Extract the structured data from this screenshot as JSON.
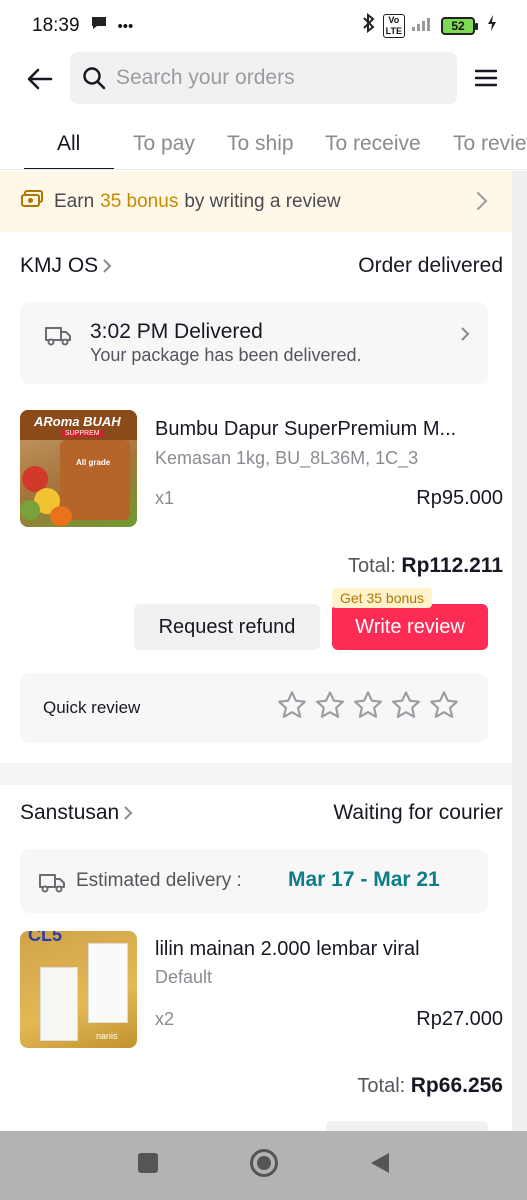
{
  "status_bar": {
    "time": "18:39",
    "dots": "•••",
    "battery": "52"
  },
  "header": {
    "search_placeholder": "Search your orders"
  },
  "tabs": [
    {
      "label": "All"
    },
    {
      "label": "To pay"
    },
    {
      "label": "To ship"
    },
    {
      "label": "To receive"
    },
    {
      "label": "To review"
    }
  ],
  "banner": {
    "prefix": "Earn",
    "bonus": "35 bonus",
    "suffix": "by writing a review"
  },
  "orders": [
    {
      "shop": "KMJ OS",
      "status": "Order delivered",
      "delivery_title": "3:02 PM Delivered",
      "delivery_sub": "Your package has been delivered.",
      "product_name": "Bumbu Dapur SuperPremium M...",
      "variant": "Kemasan 1kg, BU_8L36M, 1C_3",
      "qty": "x1",
      "price": "Rp95.000",
      "total_label": "Total:",
      "total": "Rp112.211",
      "refund_label": "Request refund",
      "review_label": "Write review",
      "bonus_tag": "Get 35 bonus",
      "quick_review_label": "Quick review",
      "image_text_top": "ARoma BUAH",
      "image_text_sub": "SUPPREM",
      "image_text_grade": "All grade"
    },
    {
      "shop": "Sanstusan",
      "status": "Waiting for courier",
      "delivery_prefix": "Estimated delivery :",
      "delivery_dates": "Mar 17 - Mar 21",
      "product_name": "lilin mainan 2.000 lembar viral",
      "variant": "Default",
      "qty": "x2",
      "price": "Rp27.000",
      "total_label": "Total:",
      "total": "Rp66.256",
      "image_text_top": "CL5",
      "image_text_mark": "nanis"
    }
  ],
  "colors": {
    "accent": "#fe2c55",
    "bonus": "#c58a00",
    "teal": "#0f7d86",
    "banner_bg": "#fff7e8"
  }
}
